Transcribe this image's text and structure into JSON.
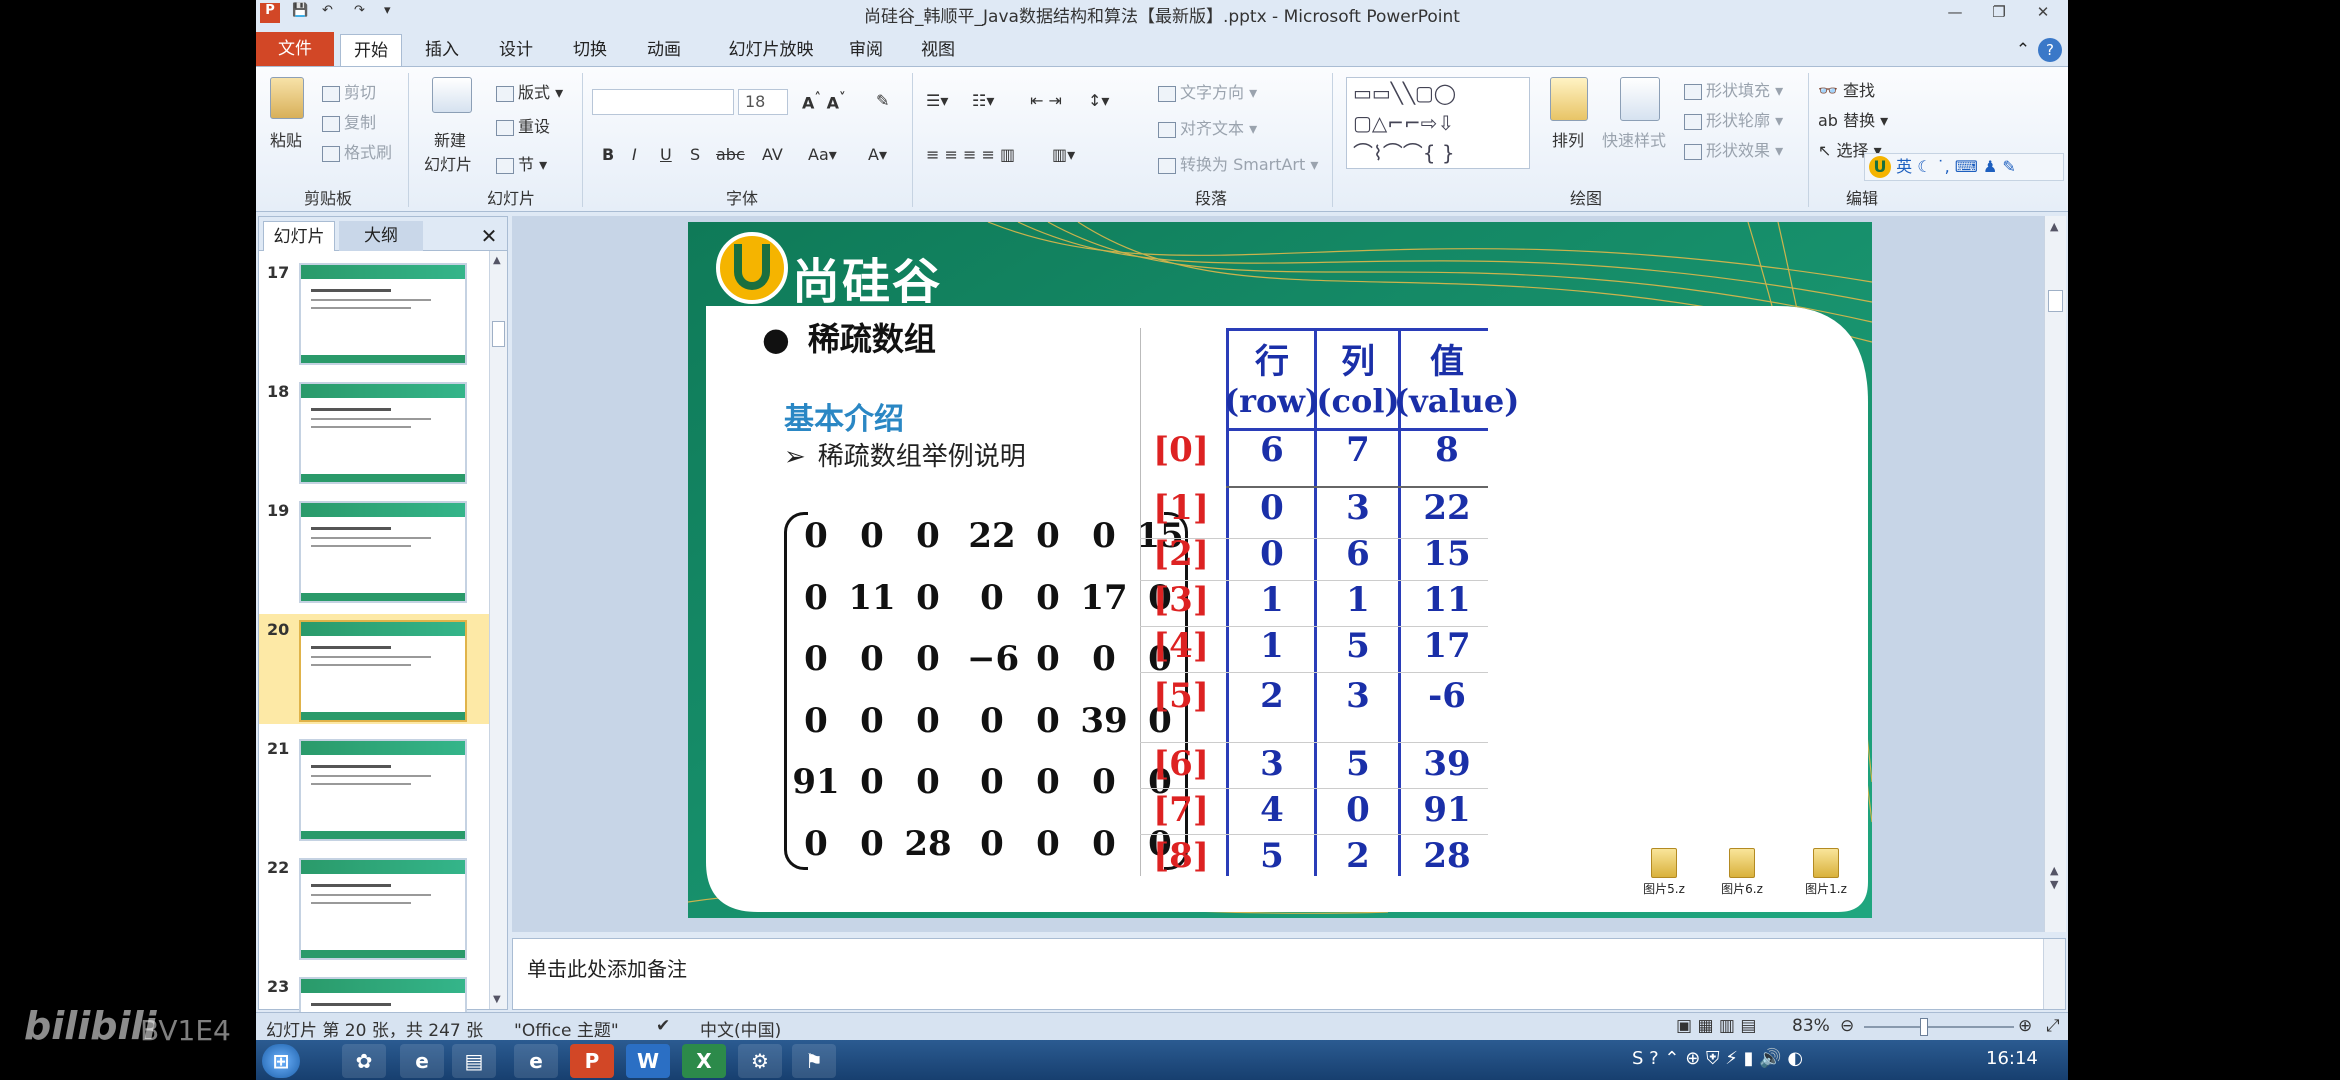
{
  "window": {
    "title": "尚硅谷_韩顺平_Java数据结构和算法【最新版】.pptx - Microsoft PowerPoint"
  },
  "tabs": [
    "文件",
    "开始",
    "插入",
    "设计",
    "切换",
    "动画",
    "幻灯片放映",
    "审阅",
    "视图"
  ],
  "ribbon": {
    "clipboard": {
      "paste": "粘贴",
      "cut": "剪切",
      "copy": "复制",
      "format_painter": "格式刷",
      "group": "剪贴板"
    },
    "slides": {
      "new_slide": "新建",
      "new_slide2": "幻灯片",
      "layout": "版式",
      "reset": "重设",
      "section": "节",
      "group": "幻灯片"
    },
    "font": {
      "size": "18",
      "group": "字体"
    },
    "paragraph": {
      "text_direction": "文字方向",
      "align_text": "对齐文本",
      "smartart": "转换为 SmartArt",
      "group": "段落"
    },
    "drawing": {
      "arrange": "排列",
      "quick_styles": "快速样式",
      "shape_fill": "形状填充",
      "shape_outline": "形状轮廓",
      "shape_effects": "形状效果",
      "group": "绘图"
    },
    "editing": {
      "find": "查找",
      "replace": "替换",
      "select": "选择",
      "group": "编辑"
    },
    "ime": "英"
  },
  "left_panel": {
    "tabs": [
      "幻灯片",
      "大纲"
    ],
    "slide_numbers": [
      "17",
      "18",
      "19",
      "20",
      "21",
      "22",
      "23"
    ]
  },
  "slide": {
    "logo": "尚硅谷",
    "title": "稀疏数组",
    "subtitle": "基本介绍",
    "bullet": "稀疏数组举例说明",
    "matrix": [
      [
        "0",
        "0",
        "0",
        "22",
        "0",
        "0",
        "15"
      ],
      [
        "0",
        "11",
        "0",
        "0",
        "0",
        "17",
        "0"
      ],
      [
        "0",
        "0",
        "0",
        "−6",
        "0",
        "0",
        "0"
      ],
      [
        "0",
        "0",
        "0",
        "0",
        "0",
        "39",
        "0"
      ],
      [
        "91",
        "0",
        "0",
        "0",
        "0",
        "0",
        "0"
      ],
      [
        "0",
        "0",
        "28",
        "0",
        "0",
        "0",
        "0"
      ]
    ],
    "table_headers": [
      {
        "cn": "行",
        "en": "(row)"
      },
      {
        "cn": "列",
        "en": "(col)"
      },
      {
        "cn": "值",
        "en": "(value)"
      }
    ],
    "table_rows": [
      {
        "idx": "[0]",
        "row": "6",
        "col": "7",
        "value": "8"
      },
      {
        "idx": "[1]",
        "row": "0",
        "col": "3",
        "value": "22"
      },
      {
        "idx": "[2]",
        "row": "0",
        "col": "6",
        "value": "15"
      },
      {
        "idx": "[3]",
        "row": "1",
        "col": "1",
        "value": "11"
      },
      {
        "idx": "[4]",
        "row": "1",
        "col": "5",
        "value": "17"
      },
      {
        "idx": "[5]",
        "row": "2",
        "col": "3",
        "value": "-6"
      },
      {
        "idx": "[6]",
        "row": "3",
        "col": "5",
        "value": "39"
      },
      {
        "idx": "[7]",
        "row": "4",
        "col": "0",
        "value": "91"
      },
      {
        "idx": "[8]",
        "row": "5",
        "col": "2",
        "value": "28"
      }
    ],
    "files": [
      "图片5.z",
      "图片6.z",
      "图片1.z"
    ]
  },
  "notes_placeholder": "单击此处添加备注",
  "status": {
    "slide_info": "幻灯片 第 20 张，共 247 张",
    "theme": "\"Office 主题\"",
    "language": "中文(中国)",
    "zoom": "83%"
  },
  "taskbar": {
    "clock": "16:14"
  },
  "watermark": "BV1E4"
}
